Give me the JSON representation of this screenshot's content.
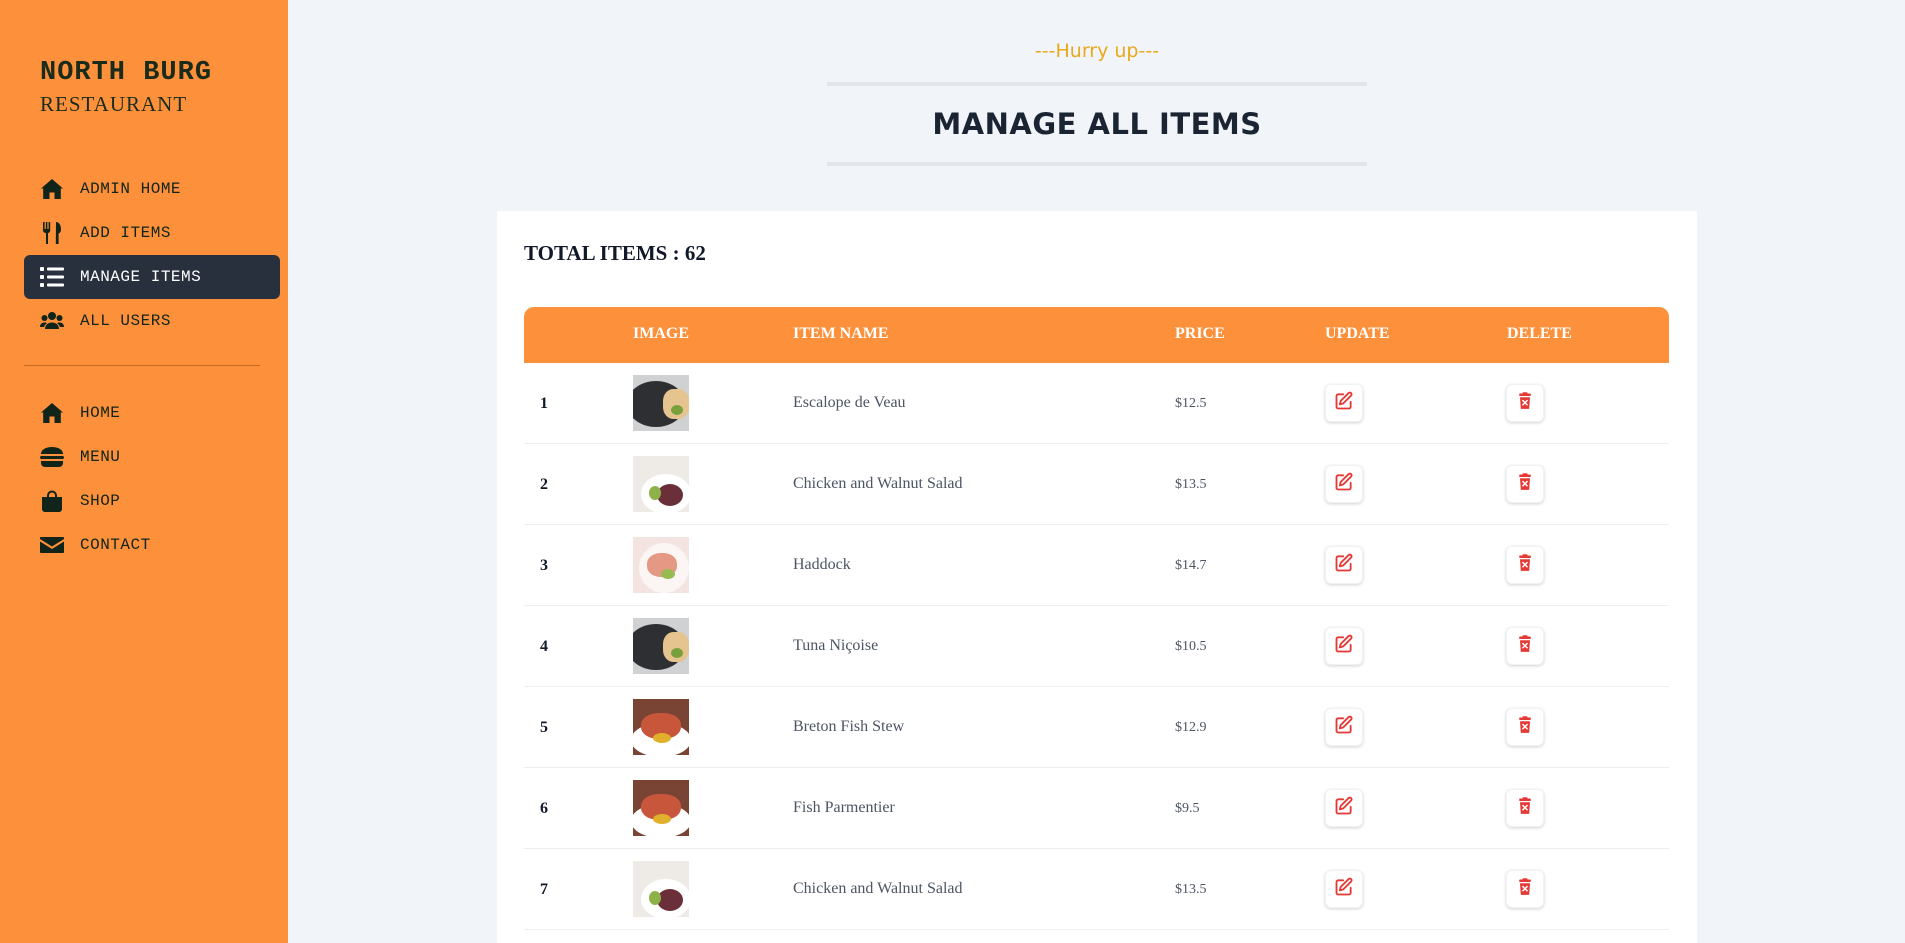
{
  "brand": {
    "title": "NORTH BURG",
    "subtitle": "RESTAURANT"
  },
  "sidebar": {
    "admin_items": [
      {
        "label": "ADMIN HOME",
        "icon": "home-icon",
        "active": false
      },
      {
        "label": "ADD ITEMS",
        "icon": "utensils-icon",
        "active": false
      },
      {
        "label": "MANAGE ITEMS",
        "icon": "list-icon",
        "active": true
      },
      {
        "label": "ALL USERS",
        "icon": "users-icon",
        "active": false
      }
    ],
    "site_items": [
      {
        "label": "HOME",
        "icon": "home-icon"
      },
      {
        "label": "MENU",
        "icon": "burger-icon"
      },
      {
        "label": "SHOP",
        "icon": "shopping-bag-icon"
      },
      {
        "label": "CONTACT",
        "icon": "envelope-icon"
      }
    ]
  },
  "section": {
    "subheading": "---Hurry up---",
    "heading": "MANAGE ALL ITEMS"
  },
  "summary": {
    "total_label": "TOTAL ITEMS : 62"
  },
  "table": {
    "headers": {
      "image": "IMAGE",
      "name": "ITEM NAME",
      "price": "PRICE",
      "update": "UPDATE",
      "delete": "DELETE"
    },
    "rows": [
      {
        "num": "1",
        "name": "Escalope de Veau",
        "price": "$12.5",
        "thumb": "food-a"
      },
      {
        "num": "2",
        "name": "Chicken and Walnut Salad",
        "price": "$13.5",
        "thumb": "food-b"
      },
      {
        "num": "3",
        "name": "Haddock",
        "price": "$14.7",
        "thumb": "food-c"
      },
      {
        "num": "4",
        "name": "Tuna Niçoise",
        "price": "$10.5",
        "thumb": "food-a"
      },
      {
        "num": "5",
        "name": "Breton Fish Stew",
        "price": "$12.9",
        "thumb": "food-d"
      },
      {
        "num": "6",
        "name": "Fish Parmentier",
        "price": "$9.5",
        "thumb": "food-d"
      },
      {
        "num": "7",
        "name": "Chicken and Walnut Salad",
        "price": "$13.5",
        "thumb": "food-b"
      }
    ]
  },
  "colors": {
    "sidebar": "#fd913b",
    "active_nav": "#282f3d",
    "accent_text": "#e8a91a",
    "action_icon": "#e53935"
  }
}
